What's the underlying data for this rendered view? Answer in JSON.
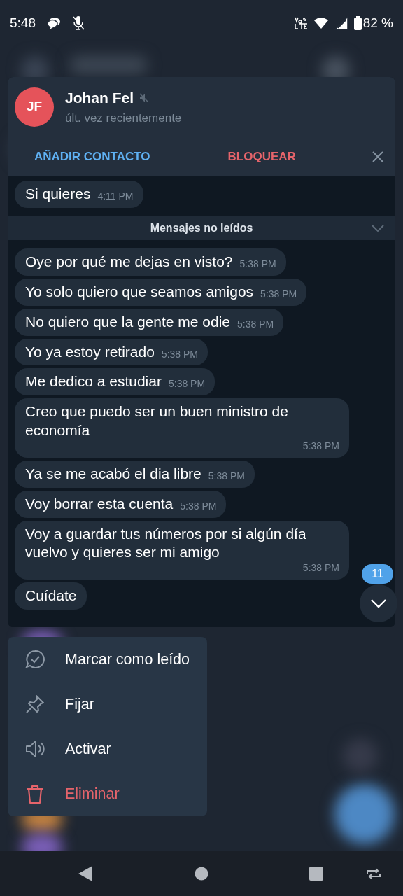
{
  "status_bar": {
    "time": "5:48",
    "battery": "82 %"
  },
  "chat_preview": {
    "avatar_initials": "JF",
    "name": "Johan Fel",
    "muted": true,
    "last_seen": "últ. vez recientemente",
    "actions": [
      {
        "label": "AÑADIR CONTACTO",
        "kind": "add"
      },
      {
        "label": "BLOQUEAR",
        "kind": "block"
      }
    ],
    "read_messages": [
      {
        "text": "Si quieres",
        "time": "4:11 PM"
      }
    ],
    "unread_label": "Mensajes no leídos",
    "unread_messages": [
      {
        "text": "Oye por qué me dejas en visto?",
        "time": "5:38 PM"
      },
      {
        "text": "Yo solo quiero que seamos amigos",
        "time": "5:38 PM"
      },
      {
        "text": "No quiero que la gente me odie",
        "time": "5:38 PM"
      },
      {
        "text": "Yo ya estoy retirado",
        "time": "5:38 PM"
      },
      {
        "text": "Me dedico a estudiar",
        "time": "5:38 PM"
      },
      {
        "text": "Creo que puedo ser un buen ministro de economía",
        "time": "5:38 PM"
      },
      {
        "text": "Ya se me acabó el dia libre",
        "time": "5:38 PM"
      },
      {
        "text": "Voy borrar esta cuenta",
        "time": "5:38 PM"
      },
      {
        "text": "Voy a guardar tus números por si algún día vuelvo y quieres ser mi amigo",
        "time": "5:38 PM"
      },
      {
        "text": "Cuídate"
      }
    ],
    "unread_count": "11"
  },
  "context_menu": [
    {
      "label": "Marcar como leído",
      "kind": "mark_read"
    },
    {
      "label": "Fijar",
      "kind": "pin"
    },
    {
      "label": "Activar",
      "kind": "unmute"
    },
    {
      "label": "Eliminar",
      "kind": "delete"
    }
  ]
}
